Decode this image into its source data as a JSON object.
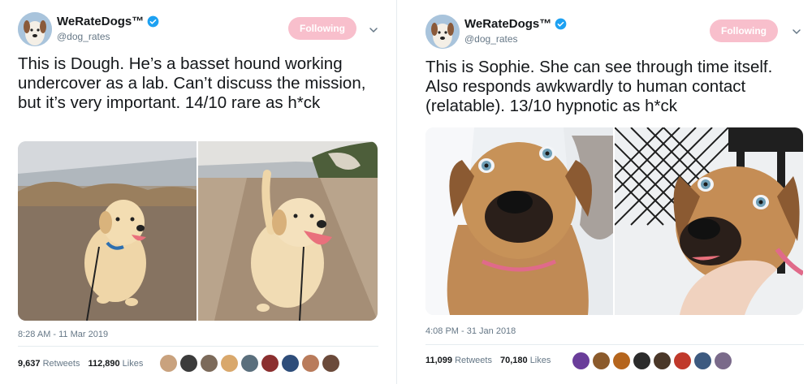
{
  "tweets": [
    {
      "display_name": "WeRateDogs™",
      "handle": "@dog_rates",
      "follow_label": "Following",
      "text": "This is Dough. He’s a basset hound working undercover as a lab. Can’t discuss the mission, but it’s very important. 14/10 rare as h*ck",
      "timestamp": "8:28 AM - 11 Mar 2019",
      "retweets_count": "9,637",
      "retweets_label": "Retweets",
      "likes_count": "112,890",
      "likes_label": "Likes",
      "liker_colors": [
        "#c9a27e",
        "#3b3b3b",
        "#7c6a5a",
        "#d9a86c",
        "#5a6f7d",
        "#8b2f2f",
        "#2e4d7a",
        "#b97b5b",
        "#6b4a3a"
      ]
    },
    {
      "display_name": "WeRateDogs™",
      "handle": "@dog_rates",
      "follow_label": "Following",
      "text": "This is Sophie. She can see through time itself. Also responds awkwardly to human contact (relatable). 13/10 hypnotic as h*ck",
      "timestamp": "4:08 PM - 31 Jan 2018",
      "retweets_count": "11,099",
      "retweets_label": "Retweets",
      "likes_count": "70,180",
      "likes_label": "Likes",
      "liker_colors": [
        "#6a3d9a",
        "#8b5a2b",
        "#b5651d",
        "#2b2b2b",
        "#4a3728",
        "#c0392b",
        "#3d5a80",
        "#7a6a8a"
      ]
    }
  ],
  "colors": {
    "verified": "#1da1f2",
    "follow_button": "#f8bfcc",
    "secondary_text": "#657786"
  },
  "icons": [
    "verified-badge-icon",
    "chevron-down-icon"
  ]
}
